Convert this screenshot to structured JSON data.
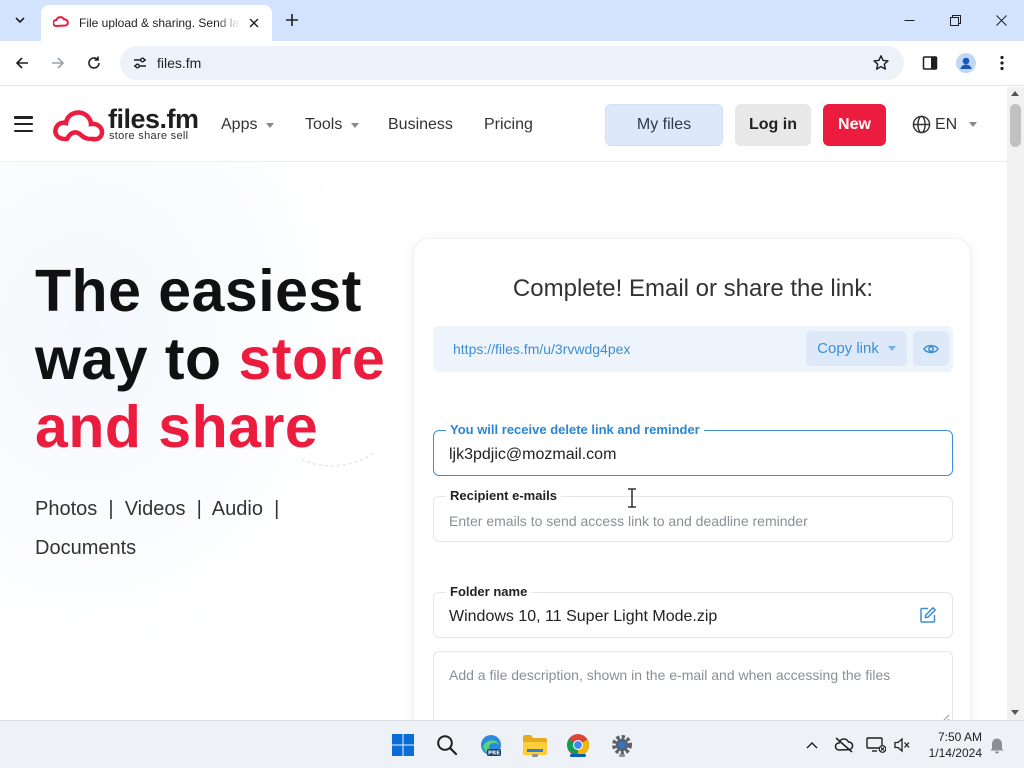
{
  "browser": {
    "tab_title": "File upload & sharing. Send large files",
    "url": "files.fm"
  },
  "header": {
    "logo_name": "files.fm",
    "logo_tagline": "store share sell",
    "nav": {
      "apps": "Apps",
      "tools": "Tools",
      "business": "Business",
      "pricing": "Pricing"
    },
    "my_files": "My files",
    "log_in": "Log in",
    "new": "New",
    "language": "EN"
  },
  "hero": {
    "line1": "The easiest",
    "line2_prefix": "way to ",
    "line2_accent": "store",
    "line3": "and share",
    "categories_line1": "Photos  |  Videos  |  Audio  |",
    "categories_line2": "Documents"
  },
  "card": {
    "title": "Complete! Email or share the link:",
    "share_link": "https://files.fm/u/3rvwdg4pex",
    "copy_link": "Copy link",
    "email_label": "You will receive delete link and reminder",
    "email_value": "ljk3pdjic@mozmail.com",
    "recipients_label": "Recipient e-mails",
    "recipients_placeholder": "Enter emails to send access link to and deadline reminder",
    "folder_label": "Folder name",
    "folder_value": "Windows 10, 11 Super Light Mode.zip",
    "description_placeholder": "Add a file description, shown in the e-mail and when accessing the files"
  },
  "taskbar": {
    "time": "7:50 AM",
    "date": "1/14/2024"
  },
  "colors": {
    "accent_red": "#eb1c3d",
    "link_blue": "#3c8fd6",
    "chrome_tabbar": "#d3e3fd"
  }
}
